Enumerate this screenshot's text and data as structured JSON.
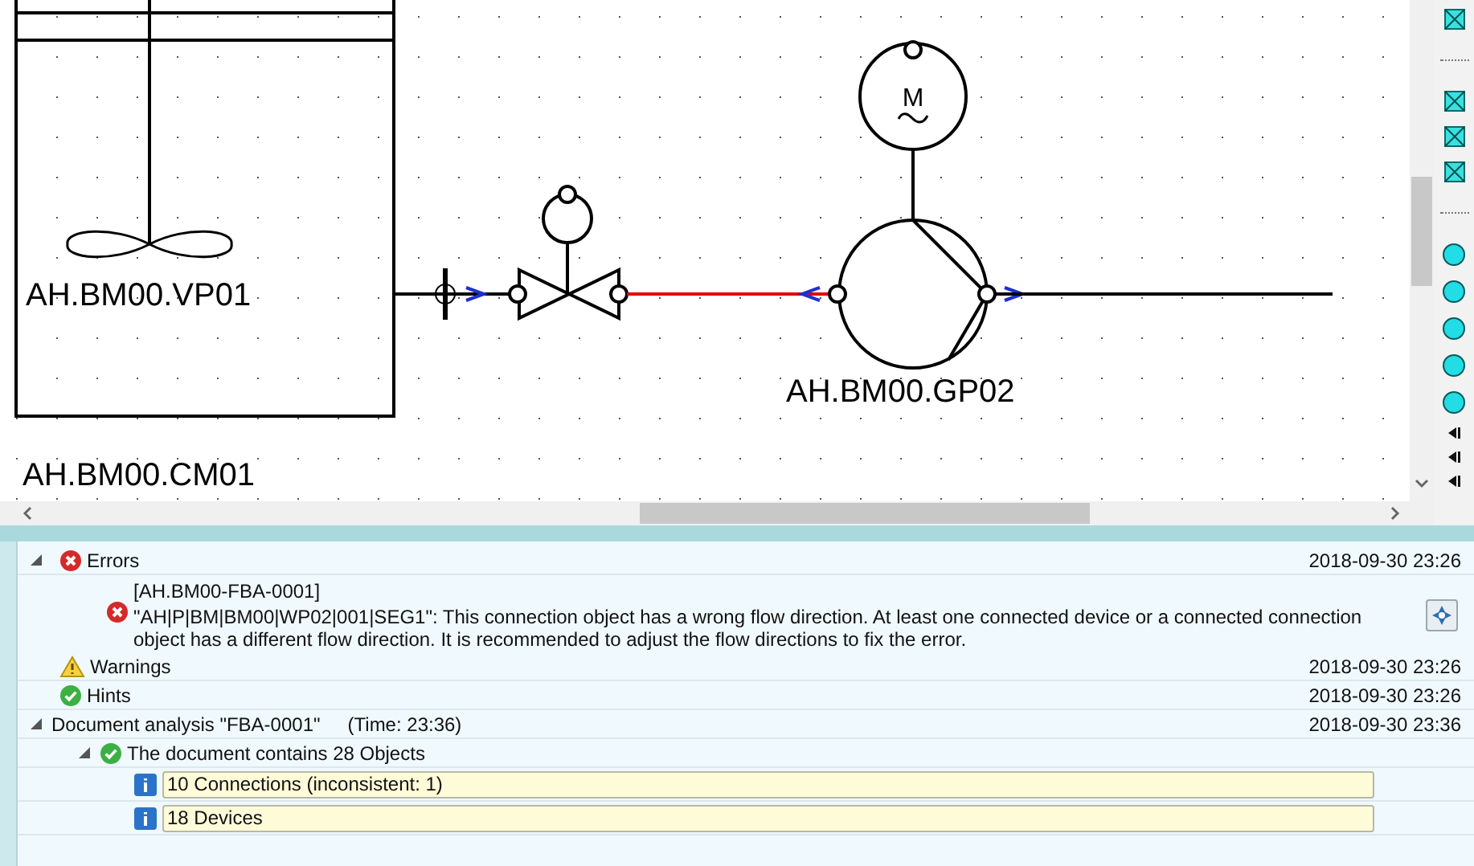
{
  "diagram": {
    "labels": [
      "AH.BM00.VP01",
      "AH.BM00.CM01",
      "AH.BM00.GP02"
    ],
    "motor_label": "M"
  },
  "log": [
    {
      "kind": "errors",
      "label": "Errors",
      "time": "2018-09-30 23:26",
      "expanded": true,
      "children": [
        {
          "kind": "error_message",
          "ref": "[AH.BM00-FBA-0001]",
          "text": "\"AH|P|BM|BM00|WP02|001|SEG1\": This connection object has a wrong flow direction. At least one connected device or a connected connection object has a different flow direction. It is recommended to adjust the flow directions to fix the error."
        }
      ]
    },
    {
      "kind": "warnings",
      "label": "Warnings",
      "time": "2018-09-30 23:26"
    },
    {
      "kind": "hints",
      "label": "Hints",
      "time": "2018-09-30 23:26"
    },
    {
      "kind": "analysis",
      "label": "Document analysis \"FBA-0001\"",
      "detail": "(Time: 23:36)",
      "time": "2018-09-30 23:36",
      "expanded": true,
      "children": [
        {
          "kind": "summary",
          "label": "The document contains 28 Objects",
          "expanded": true,
          "children": [
            {
              "kind": "info",
              "text": "10 Connections (inconsistent: 1)"
            },
            {
              "kind": "info",
              "text": "18 Devices"
            }
          ]
        }
      ]
    }
  ]
}
